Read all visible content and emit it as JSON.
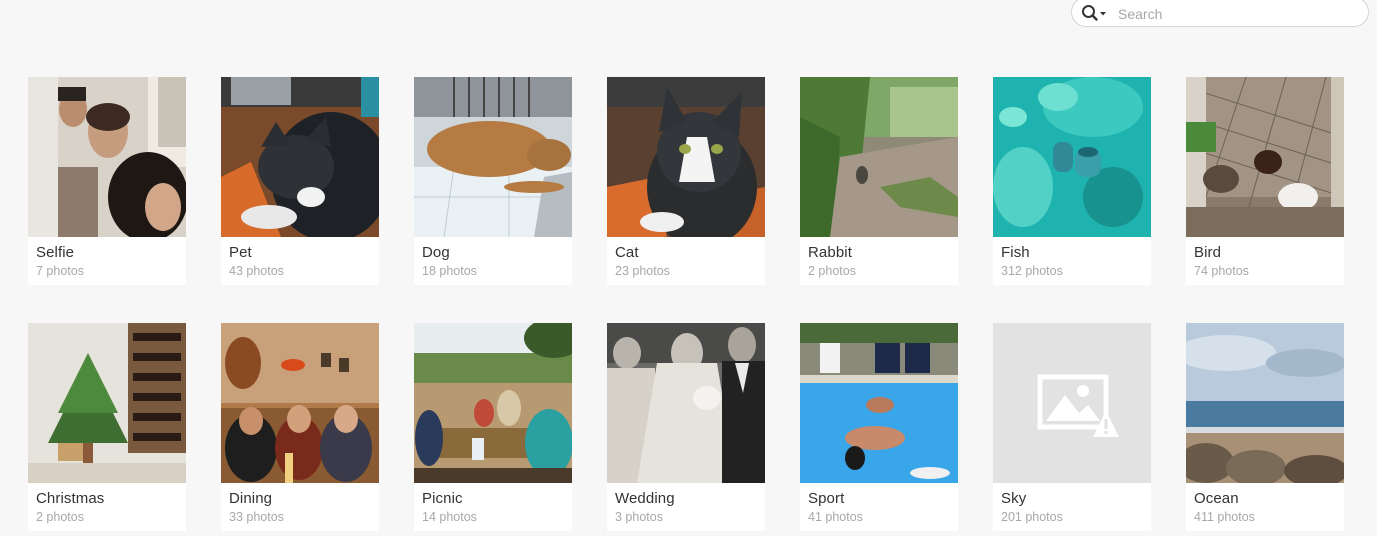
{
  "search": {
    "icon": "search-icon",
    "dropdown_icon": "caret-down-icon",
    "placeholder": "Search"
  },
  "albums": [
    {
      "title": "Selfie",
      "count": "7 photos"
    },
    {
      "title": "Pet",
      "count": "43 photos"
    },
    {
      "title": "Dog",
      "count": "18 photos"
    },
    {
      "title": "Cat",
      "count": "23 photos"
    },
    {
      "title": "Rabbit",
      "count": "2 photos"
    },
    {
      "title": "Fish",
      "count": "312 photos"
    },
    {
      "title": "Bird",
      "count": "74 photos"
    },
    {
      "title": "Christmas",
      "count": "2 photos"
    },
    {
      "title": "Dining",
      "count": "33 photos"
    },
    {
      "title": "Picnic",
      "count": "14 photos"
    },
    {
      "title": "Wedding",
      "count": "3 photos"
    },
    {
      "title": "Sport",
      "count": "41 photos"
    },
    {
      "title": "Sky",
      "count": "201 photos",
      "thumbnail": "image-broken-icon"
    },
    {
      "title": "Ocean",
      "count": "411 photos"
    }
  ]
}
